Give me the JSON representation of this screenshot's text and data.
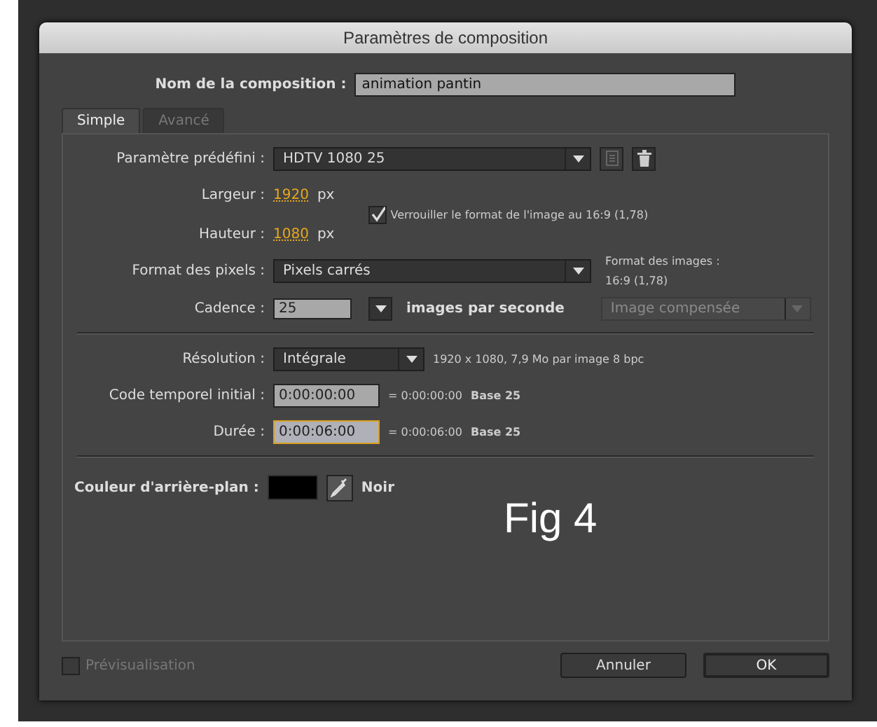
{
  "window": {
    "title": "Paramètres de composition"
  },
  "name_field": {
    "label": "Nom de la composition :",
    "value": "animation pantin"
  },
  "tabs": [
    {
      "label": "Simple",
      "selected": true
    },
    {
      "label": "Avancé",
      "selected": false
    }
  ],
  "preset": {
    "label": "Paramètre prédéfini :",
    "value": "HDTV 1080 25"
  },
  "width": {
    "label": "Largeur :",
    "value": "1920",
    "unit": "px"
  },
  "height": {
    "label": "Hauteur :",
    "value": "1080",
    "unit": "px"
  },
  "lock_ratio": {
    "label": "Verrouiller le format de l'image au 16:9 (1,78)",
    "checked": true
  },
  "pixel_format": {
    "label": "Format des pixels :",
    "value": "Pixels carrés",
    "aspect_label": "Format des images :",
    "aspect_value": "16:9 (1,78)"
  },
  "frame_rate": {
    "label": "Cadence :",
    "value": "25",
    "unit": "images par seconde",
    "blend": {
      "value": "Image compensée",
      "disabled": true
    }
  },
  "resolution": {
    "label": "Résolution :",
    "value": "Intégrale",
    "info": "1920 x 1080, 7,9 Mo par image 8 bpc"
  },
  "timecodes": [
    {
      "label": "Code temporel initial :",
      "value": "0:00:00:00",
      "info": "= 0:00:00:00",
      "base": "Base 25",
      "focused": false
    },
    {
      "label": "Durée :",
      "value": "0:00:06:00",
      "info": "= 0:00:06:00",
      "base": "Base 25",
      "focused": true
    }
  ],
  "background": {
    "label": "Couleur d'arrière-plan :",
    "color": "#000000",
    "name": "Noir"
  },
  "figure_label": "Fig 4",
  "preview": {
    "label": "Prévisualisation",
    "checked": false,
    "disabled": true
  },
  "buttons": [
    {
      "label": "Annuler",
      "default": false
    },
    {
      "label": "OK",
      "default": true
    }
  ]
}
